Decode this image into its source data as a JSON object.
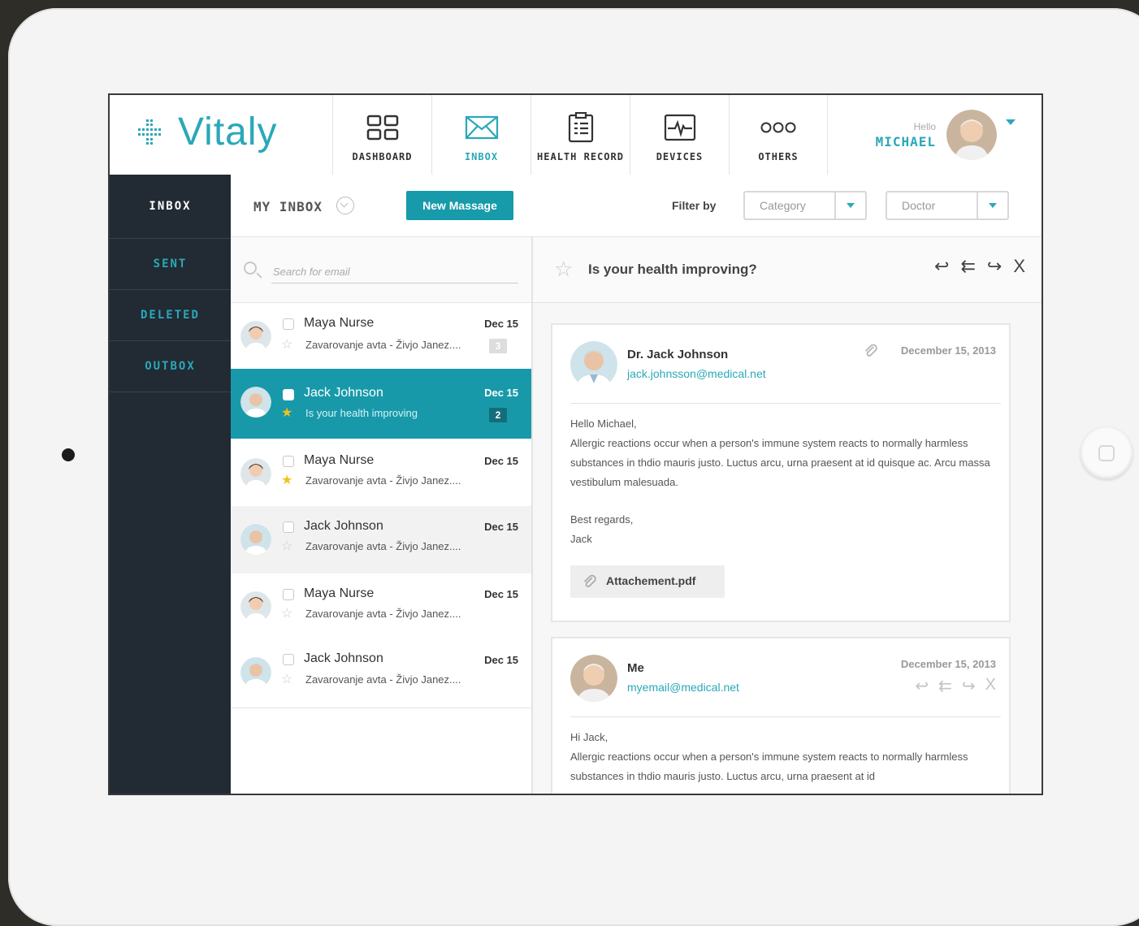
{
  "app": {
    "logo_text": "Vitaly"
  },
  "nav": [
    {
      "label": "DASHBOARD",
      "icon": "dashboard-grid-icon"
    },
    {
      "label": "INBOX",
      "icon": "envelope-icon"
    },
    {
      "label": "HEALTH RECORD",
      "icon": "clipboard-icon"
    },
    {
      "label": "DEVICES",
      "icon": "heartbeat-monitor-icon"
    },
    {
      "label": "OTHERS",
      "icon": "three-dots-icon"
    }
  ],
  "user": {
    "greeting": "Hello",
    "name": "MICHAEL"
  },
  "sidebar": [
    {
      "label": "INBOX"
    },
    {
      "label": "SENT"
    },
    {
      "label": "DELETED"
    },
    {
      "label": "OUTBOX"
    }
  ],
  "toolbar": {
    "title": "MY INBOX",
    "new_button": "New Massage",
    "filter_label": "Filter by",
    "category_value": "Category",
    "doctor_value": "Doctor"
  },
  "search": {
    "placeholder": "Search for email"
  },
  "messages": [
    {
      "name": "Maya Nurse",
      "date": "Dec 15",
      "subject": "Zavarovanje avta - Živjo Janez....",
      "badge": "3",
      "starred": false
    },
    {
      "name": "Jack Johnson",
      "date": "Dec 15",
      "subject": "Is your health improving",
      "badge": "2",
      "starred": true
    },
    {
      "name": "Maya Nurse",
      "date": "Dec 15",
      "subject": "Zavarovanje avta - Živjo Janez....",
      "badge": "",
      "starred": true
    },
    {
      "name": "Jack Johnson",
      "date": "Dec 15",
      "subject": "Zavarovanje avta - Živjo Janez....",
      "badge": "",
      "starred": false
    },
    {
      "name": "Maya Nurse",
      "date": "Dec 15",
      "subject": "Zavarovanje avta - Živjo Janez....",
      "badge": "",
      "starred": false
    },
    {
      "name": "Jack Johnson",
      "date": "Dec 15",
      "subject": "Zavarovanje avta - Živjo Janez....",
      "badge": "",
      "starred": false
    }
  ],
  "reading": {
    "subject": "Is your health improving?",
    "actions": {
      "reply": "↩",
      "reply_all": "⇇",
      "forward": "↪",
      "close": "X"
    },
    "thread": [
      {
        "from": "Dr. Jack Johnson",
        "email": "jack.johnsson@medical.net",
        "date": "December 15, 2013",
        "greeting": "Hello Michael,",
        "body": "Allergic reactions occur when a person's immune system reacts to normally harmless substances in thdio mauris justo. Luctus arcu, urna praesent at id quisque ac. Arcu massa vestibulum malesuada.",
        "signoff": "Best regards,",
        "signature": "Jack",
        "attachment": "Attachement.pdf"
      },
      {
        "from": "Me",
        "email": "myemail@medical.net",
        "date": "December 15, 2013",
        "greeting": "Hi Jack,",
        "body": "Allergic reactions occur when a person's immune system reacts to normally harmless substances in thdio mauris justo. Luctus arcu, urna praesent at id"
      }
    ]
  },
  "colors": {
    "accent": "#2aa8b8",
    "selected_row": "#1899aa",
    "sidebar_bg": "#222a33",
    "star_on": "#f2c31c"
  }
}
